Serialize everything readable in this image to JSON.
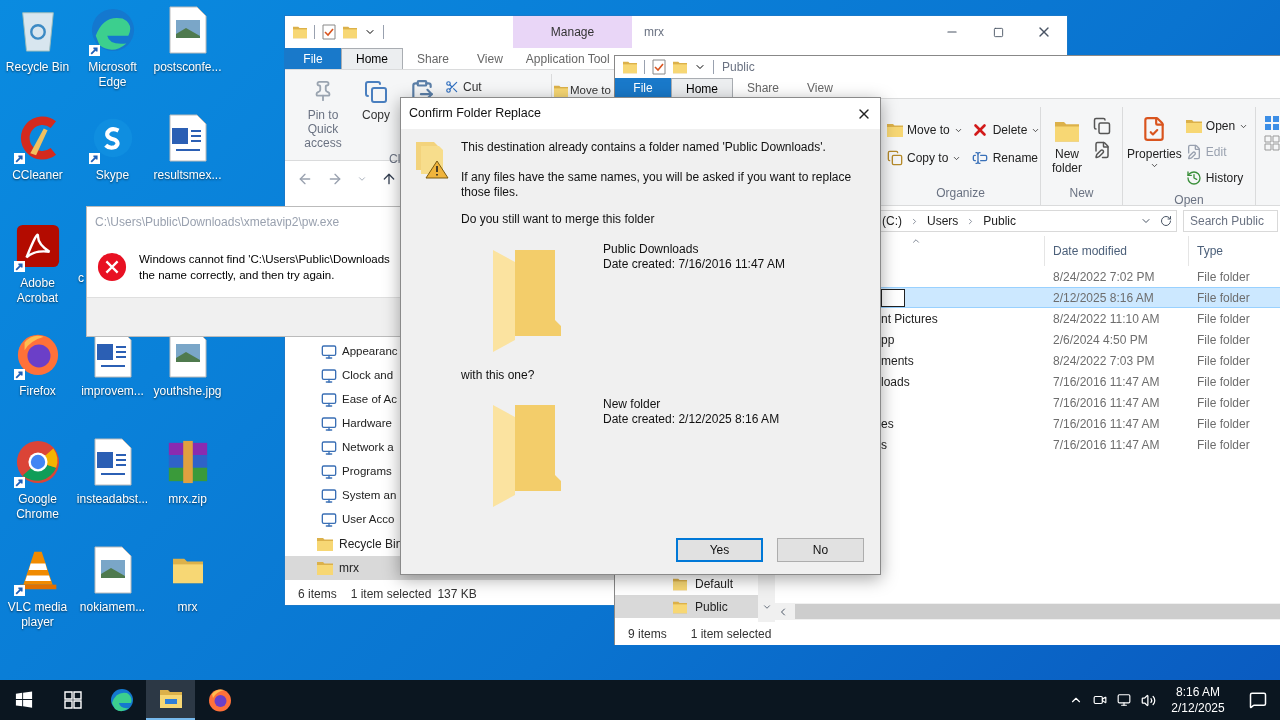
{
  "desktop": {
    "rows": [
      [
        {
          "label": "Recycle Bin",
          "shortcut": false
        },
        {
          "label": "Microsoft Edge",
          "shortcut": true
        },
        {
          "label": "postsconfe...",
          "shortcut": false
        }
      ],
      [
        {
          "label": "CCleaner",
          "shortcut": true
        },
        {
          "label": "Skype",
          "shortcut": true
        },
        {
          "label": "resultsmex...",
          "shortcut": false
        }
      ],
      [
        {
          "label": "Adobe Acrobat",
          "shortcut": true
        },
        {
          "label": "c"
        }
      ],
      [
        {
          "label": "Firefox",
          "shortcut": true
        },
        {
          "label": "improvem...",
          "shortcut": false
        },
        {
          "label": "youthshe.jpg",
          "shortcut": false
        }
      ],
      [
        {
          "label": "Google Chrome",
          "shortcut": true
        },
        {
          "label": "insteadabst...",
          "shortcut": false
        },
        {
          "label": "mrx.zip",
          "shortcut": false
        }
      ],
      [
        {
          "label": "VLC media player",
          "shortcut": true
        },
        {
          "label": "nokiamem...",
          "shortcut": false
        },
        {
          "label": "mrx",
          "shortcut": false
        }
      ]
    ]
  },
  "back_window": {
    "title": "mrx",
    "context_tab": "Manage",
    "tabs": [
      {
        "label": "File",
        "kind": "menu",
        "selected": false
      },
      {
        "label": "Home",
        "kind": "tab",
        "selected": true
      },
      {
        "label": "Share",
        "kind": "tab",
        "selected": false
      },
      {
        "label": "View",
        "kind": "tab",
        "selected": false
      },
      {
        "label": "Application Tool",
        "kind": "tab",
        "selected": false
      }
    ],
    "ribbon": {
      "pin": "Pin to Quick access",
      "copy": "Copy",
      "cut": "Cut",
      "group_label": "Cl",
      "move_to": "Move to"
    },
    "tree": [
      {
        "children": [
          {
            "label": "Appearanc",
            "selected": false
          },
          {
            "label": "Clock and",
            "selected": false
          },
          {
            "label": "Ease of Ac",
            "selected": false
          },
          {
            "label": "Hardware",
            "selected": false
          },
          {
            "label": "Network a",
            "selected": false
          },
          {
            "label": "Programs",
            "selected": false
          },
          {
            "label": "System an",
            "selected": false
          },
          {
            "label": "User Acco",
            "selected": false
          }
        ]
      },
      {
        "label": "Recycle Bin",
        "selected": false
      },
      {
        "label": "mrx",
        "selected": true
      }
    ],
    "status": {
      "items": "6 items",
      "selection": "1 item selected",
      "size": "137 KB"
    }
  },
  "error_dialog": {
    "title": "C:\\Users\\Public\\Downloads\\xmetavip2\\pw.exe",
    "message_lines": [
      "Windows cannot find 'C:\\Users\\Public\\Downloads",
      "the name correctly, and then try again."
    ]
  },
  "front_window": {
    "title": "Public",
    "tabs": [
      {
        "label": "File",
        "kind": "menu",
        "selected": false
      },
      {
        "label": "Home",
        "kind": "tab",
        "selected": true
      },
      {
        "label": "Share",
        "kind": "tab",
        "selected": false
      },
      {
        "label": "View",
        "kind": "tab",
        "selected": false
      }
    ],
    "ribbon": {
      "organize": {
        "label": "Organize",
        "commands": [
          {
            "label": "Move to",
            "dropdown": true
          },
          {
            "label": "Delete",
            "dropdown": true
          },
          {
            "label": "Copy to",
            "dropdown": true
          },
          {
            "label": "Rename",
            "dropdown": false
          }
        ]
      },
      "new": {
        "label": "New",
        "new_folder": "New folder"
      },
      "open": {
        "label": "Open",
        "properties": "Properties",
        "commands": [
          {
            "label": "Open",
            "dropdown": true,
            "disabled": false
          },
          {
            "label": "Edit",
            "dropdown": false,
            "disabled": true
          },
          {
            "label": "History",
            "dropdown": false,
            "disabled": false
          }
        ]
      }
    },
    "address": [
      "(C:)",
      "Users",
      "Public"
    ],
    "search": {
      "placeholder": "Search Public"
    },
    "columns": [
      "Date modified",
      "Type"
    ],
    "rows": [
      {
        "date": "8/24/2022 7:02 PM",
        "type": "File folder",
        "selected": false,
        "renaming": false
      },
      {
        "date": "2/12/2025 8:16 AM",
        "type": "File folder",
        "selected": true,
        "renaming": true
      },
      {
        "name": "nt Pictures",
        "date": "8/24/2022 11:10 AM",
        "type": "File folder",
        "selected": false,
        "renaming": false
      },
      {
        "name": "pp",
        "date": "2/6/2024 4:50 PM",
        "type": "File folder",
        "selected": false,
        "renaming": false
      },
      {
        "name": "ments",
        "date": "8/24/2022 7:03 PM",
        "type": "File folder",
        "selected": false,
        "renaming": false
      },
      {
        "name": "loads",
        "date": "7/16/2016 11:47 AM",
        "type": "File folder",
        "selected": false,
        "renaming": false
      },
      {
        "date": "7/16/2016 11:47 AM",
        "type": "File folder",
        "selected": false,
        "renaming": false
      },
      {
        "name": "es",
        "date": "7/16/2016 11:47 AM",
        "type": "File folder",
        "selected": false,
        "renaming": false
      },
      {
        "name": "s",
        "date": "7/16/2016 11:47 AM",
        "type": "File folder",
        "selected": false,
        "renaming": false
      }
    ],
    "nav": [
      {
        "label": "Default",
        "selected": false
      },
      {
        "label": "Public",
        "selected": true
      }
    ],
    "status": {
      "items": "9 items",
      "selection": "1 item selected"
    }
  },
  "confirm_dialog": {
    "title": "Confirm Folder Replace",
    "message": "This destination already contains a folder named 'Public Downloads'.",
    "detail": "If any files have the same names, you will be asked if you want to replace those files.",
    "question": "Do you still want to merge this folder",
    "source": {
      "name": "Public Downloads",
      "date": "Date created: 7/16/2016 11:47 AM"
    },
    "connector": "with this one?",
    "target": {
      "name": "New folder",
      "date": "Date created: 2/12/2025 8:16 AM"
    },
    "buttons": [
      {
        "label": "Yes",
        "default": true
      },
      {
        "label": "No",
        "default": false
      }
    ]
  },
  "taskbar": {
    "apps": [
      {
        "active": false
      },
      {
        "active": false
      },
      {
        "active": true
      },
      {
        "active": false
      }
    ],
    "time": "8:16 AM",
    "date": "2/12/2025"
  }
}
